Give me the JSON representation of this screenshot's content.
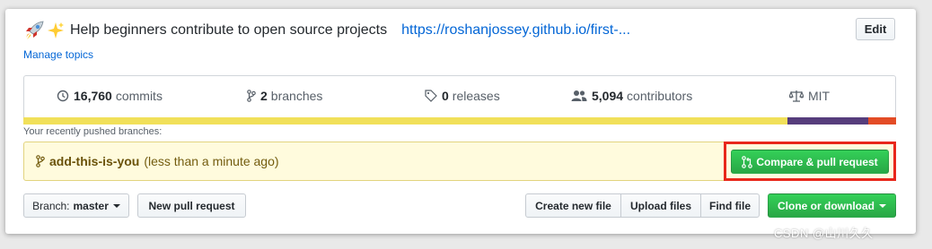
{
  "header": {
    "description": "Help beginners contribute to open source projects",
    "homepage": "https://roshanjossey.github.io/first-...",
    "edit_label": "Edit",
    "manage_topics": "Manage topics"
  },
  "summary": {
    "commits_count": "16,760",
    "commits_label": "commits",
    "branches_count": "2",
    "branches_label": "branches",
    "releases_count": "0",
    "releases_label": "releases",
    "contributors_count": "5,094",
    "contributors_label": "contributors",
    "license": "MIT"
  },
  "language_bar": [
    {
      "color": "#f1e05a",
      "share": 87.5
    },
    {
      "color": "#563d7c",
      "share": 9.3
    },
    {
      "color": "#e34c26",
      "share": 3.2
    }
  ],
  "recent": {
    "label": "Your recently pushed branches:",
    "branch_name": "add-this-is-you",
    "time": "(less than a minute ago)",
    "compare_label": "Compare & pull request"
  },
  "toolbar": {
    "branch_prefix": "Branch:",
    "branch_value": "master",
    "new_pr_label": "New pull request",
    "create_file_label": "Create new file",
    "upload_files_label": "Upload files",
    "find_file_label": "Find file",
    "clone_label": "Clone or download"
  },
  "watermark": "CSDN @山川久久",
  "colors": {
    "link": "#0366d6",
    "green": "#28a745",
    "highlight": "#e8271b"
  }
}
